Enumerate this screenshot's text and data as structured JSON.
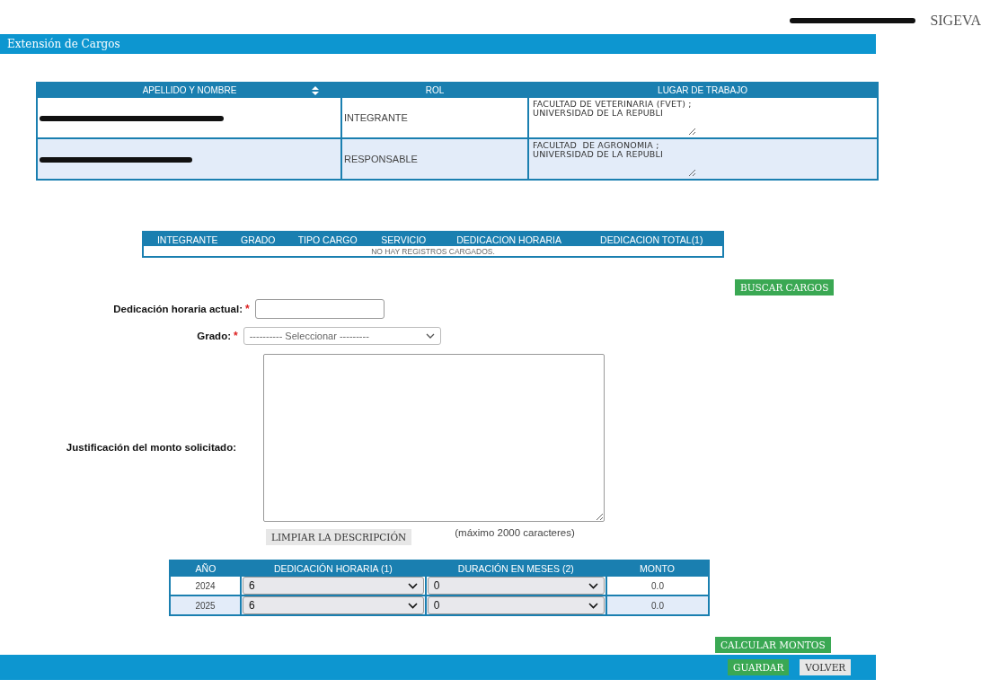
{
  "header": {
    "logo": "SIGEVA"
  },
  "title_bar": {
    "title": "Extensión de Cargos"
  },
  "members_table": {
    "columns": [
      "APELLIDO Y NOMBRE",
      "ROL",
      "LUGAR DE TRABAJO"
    ],
    "rows": [
      {
        "rol": "INTEGRANTE",
        "lugar": "FACULTAD DE VETERINARIA (FVET) ; UNIVERSIDAD DE LA REPUBLI"
      },
      {
        "rol": "RESPONSABLE",
        "lugar": "FACULTAD  DE AGRONOMIA ; UNIVERSIDAD DE LA REPUBLI"
      }
    ]
  },
  "positions_table": {
    "columns": [
      "INTEGRANTE",
      "GRADO",
      "TIPO CARGO",
      "SERVICIO",
      "DEDICACION HORARIA",
      "DEDICACION TOTAL(1)"
    ],
    "empty_message": "NO HAY REGISTROS CARGADOS."
  },
  "search_button": "BUSCAR CARGOS",
  "form": {
    "dedicacion": {
      "label": "Dedicación horaria actual:",
      "required_mark": "*"
    },
    "grado": {
      "label": "Grado:",
      "required_mark": "*",
      "value": "---------- Seleccionar ---------"
    },
    "justificacion": {
      "label": "Justificación del monto solicitado:"
    },
    "clear_button": "LIMPIAR LA DESCRIPCIÓN",
    "hint": "(máximo 2000 caracteres)"
  },
  "amounts_table": {
    "columns": [
      "AÑO",
      "DEDICACIÓN HORARIA (1)",
      "DURACIÓN EN MESES (2)",
      "MONTO"
    ],
    "rows": [
      {
        "year": "2024",
        "dedicacion": "6",
        "duracion": "0",
        "monto": "0.0"
      },
      {
        "year": "2025",
        "dedicacion": "6",
        "duracion": "0",
        "monto": "0.0"
      }
    ]
  },
  "calc_button": "CALCULAR MONTOS",
  "footer_buttons": [
    {
      "label": "GUARDAR",
      "kind": "primary"
    },
    {
      "label": "VOLVER",
      "kind": "secondary"
    }
  ]
}
